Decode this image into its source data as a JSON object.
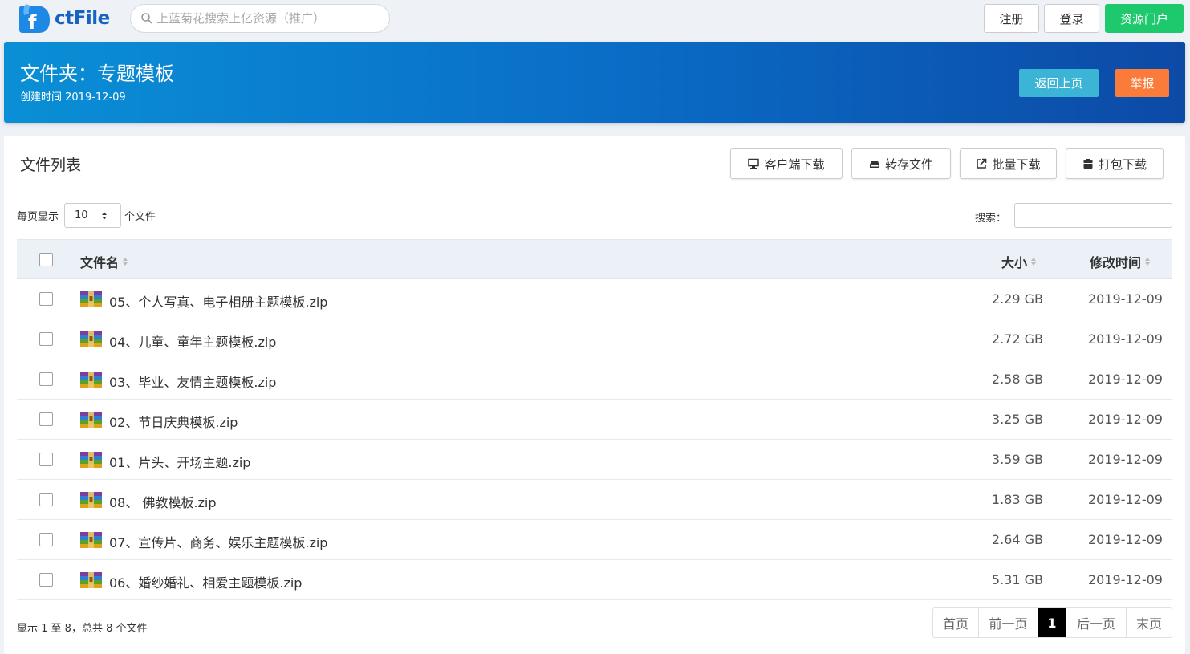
{
  "brand": {
    "name": "ctFile",
    "color": "#1565c0"
  },
  "search": {
    "placeholder": "上蓝菊花搜索上亿资源（推广）"
  },
  "nav": {
    "register": "注册",
    "login": "登录",
    "portal": "资源门户"
  },
  "folder": {
    "title": "文件夹：专题模板",
    "created": "创建时间 2019-12-09"
  },
  "actions": {
    "back": "返回上页",
    "report": "举报"
  },
  "panel": {
    "title": "文件列表",
    "tools": {
      "client": "客户端下载",
      "save": "转存文件",
      "batch": "批量下载",
      "pack": "打包下载"
    }
  },
  "length": {
    "prefix": "每页显示",
    "value": "10",
    "suffix": "个文件"
  },
  "filter": {
    "label": "搜索："
  },
  "table": {
    "headers": {
      "name": "文件名",
      "size": "大小",
      "date": "修改时间"
    },
    "rows": [
      {
        "name": "05、个人写真、电子相册主题模板.zip",
        "size": "2.29 GB",
        "date": "2019-12-09"
      },
      {
        "name": "04、儿童、童年主题模板.zip",
        "size": "2.72 GB",
        "date": "2019-12-09"
      },
      {
        "name": "03、毕业、友情主题模板.zip",
        "size": "2.58 GB",
        "date": "2019-12-09"
      },
      {
        "name": "02、节日庆典模板.zip",
        "size": "3.25 GB",
        "date": "2019-12-09"
      },
      {
        "name": "01、片头、开场主题.zip",
        "size": "3.59 GB",
        "date": "2019-12-09"
      },
      {
        "name": "08、 佛教模板.zip",
        "size": "1.83 GB",
        "date": "2019-12-09"
      },
      {
        "name": "07、宣传片、商务、娱乐主题模板.zip",
        "size": "2.64 GB",
        "date": "2019-12-09"
      },
      {
        "name": "06、婚纱婚礼、相爱主题模板.zip",
        "size": "5.31 GB",
        "date": "2019-12-09"
      }
    ]
  },
  "info": "显示 1 至 8，总共 8 个文件",
  "pagination": {
    "first": "首页",
    "prev": "前一页",
    "current": "1",
    "next": "后一页",
    "last": "末页"
  },
  "colors": {
    "banner_start": "#0a8fd6",
    "banner_end": "#0c4aa6",
    "portal": "#1ec96e",
    "back": "#3bb4d6",
    "report": "#fb7b3b"
  }
}
